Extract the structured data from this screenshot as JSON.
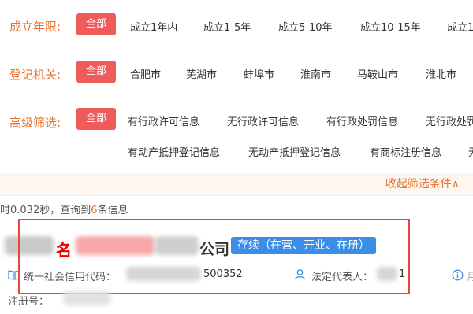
{
  "filters": {
    "establish_period": {
      "label": "成立年限:",
      "all": "全部",
      "options": [
        "成立1年内",
        "成立1-5年",
        "成立5-10年",
        "成立10-15年",
        "成立1"
      ]
    },
    "registration_authority": {
      "label": "登记机关:",
      "all": "全部",
      "options": [
        "合肥市",
        "芜湖市",
        "蚌埠市",
        "淮南市",
        "马鞍山市",
        "淮北市"
      ]
    },
    "advanced": {
      "label": "高级筛选:",
      "all": "全部",
      "options_row1": [
        "有行政许可信息",
        "无行政许可信息",
        "有行政处罚信息",
        "无行政处罚"
      ],
      "options_row2": [
        "有动产抵押登记信息",
        "无动产抵押登记信息",
        "有商标注册信息",
        "无"
      ]
    }
  },
  "collapse_label": "收起筛选条件∧",
  "result_summary": {
    "prefix": "时0.032秒，查询到",
    "count": "6",
    "suffix": "条信息"
  },
  "company": {
    "name_highlight": "名",
    "name_suffix": "公司",
    "status": "存续（在营、开业、在册）",
    "credit_code_label": "统一社会信用代码：",
    "credit_code_visible": "500352",
    "legal_rep_label": "法定代表人：",
    "legal_rep_visible": "1",
    "reg_no_label": "注册号："
  },
  "colors": {
    "accent_orange": "#e8742f",
    "button_red": "#ee5b5b",
    "status_blue": "#3b8ee8",
    "box_red": "#e8453c"
  }
}
